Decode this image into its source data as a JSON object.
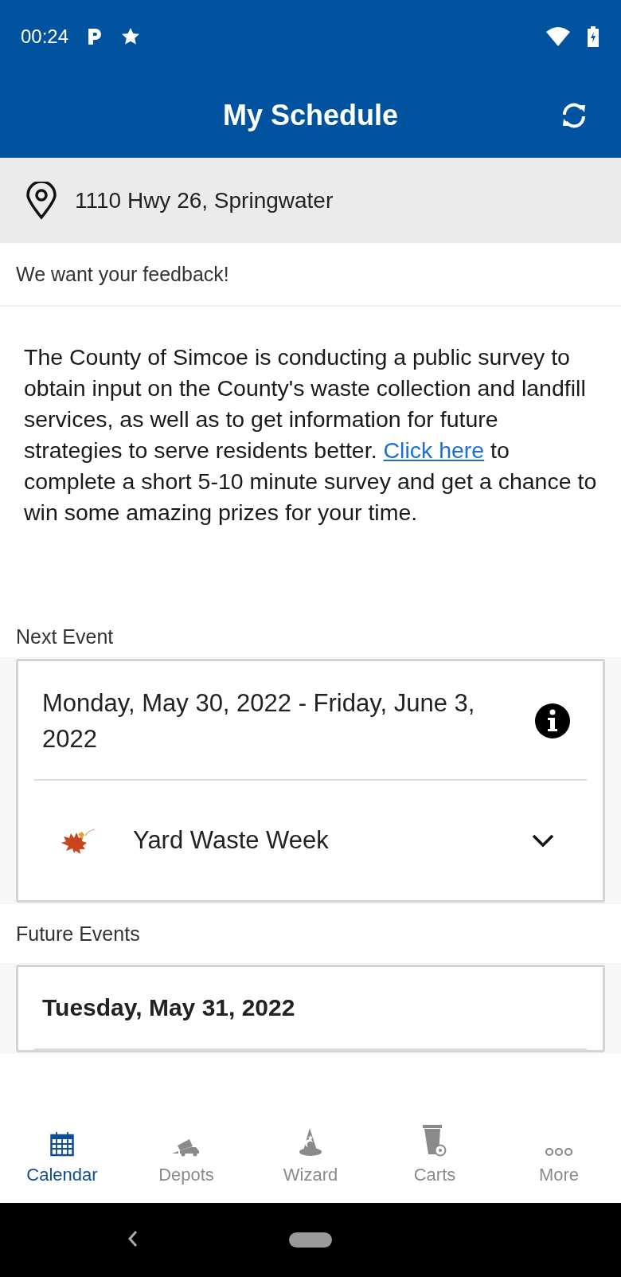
{
  "status_bar": {
    "time": "00:24"
  },
  "header": {
    "title": "My Schedule"
  },
  "address": {
    "text": "1110 Hwy 26, Springwater"
  },
  "feedback": {
    "heading": "We want your feedback!",
    "text_before": "The County of Simcoe is conducting a public survey to obtain input on the County's waste collection and landfill services, as well as to get information for future strategies to serve residents better. ",
    "link": "Click here",
    "text_after": " to complete a short 5-10 minute survey and get a chance to win some amazing prizes for your time."
  },
  "next_event": {
    "label": "Next Event",
    "date": "Monday, May 30, 2022 - Friday, June 3, 2022",
    "items": [
      {
        "name": "Yard Waste Week",
        "expanded": false
      }
    ]
  },
  "future_events": {
    "label": "Future Events",
    "events": [
      {
        "date": "Tuesday, May 31, 2022"
      }
    ]
  },
  "bottom_nav": [
    {
      "label": "Calendar",
      "kind": "calendar",
      "selected": true
    },
    {
      "label": "Depots",
      "kind": "truck",
      "selected": false
    },
    {
      "label": "Wizard",
      "kind": "hat",
      "selected": false
    },
    {
      "label": "Carts",
      "kind": "cart",
      "selected": false
    },
    {
      "label": "More",
      "kind": "more",
      "selected": false
    }
  ]
}
